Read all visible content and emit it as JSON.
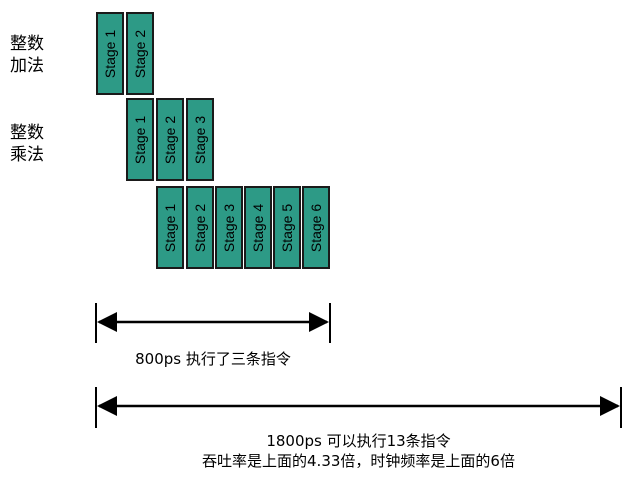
{
  "row_labels": [
    {
      "text": "整数\n加法"
    },
    {
      "text": "整数\n乘法"
    }
  ],
  "rows": [
    {
      "stages": [
        "Stage 1",
        "Stage 2"
      ]
    },
    {
      "stages": [
        "Stage 1",
        "Stage 2",
        "Stage 3"
      ]
    },
    {
      "stages": [
        "Stage 1",
        "Stage 2",
        "Stage 3",
        "Stage 4",
        "Stage 5",
        "Stage 6"
      ]
    }
  ],
  "measure_top": {
    "text": "800ps 执行了三条指令"
  },
  "measure_bottom": {
    "line1": "1800ps 可以执行13条指令",
    "line2": "吞吐率是上面的4.33倍，时钟频率是上面的6倍"
  },
  "colors": {
    "stage_fill": "#2d9a86",
    "stage_border": "#1a1a1a",
    "arrow": "#000000"
  }
}
